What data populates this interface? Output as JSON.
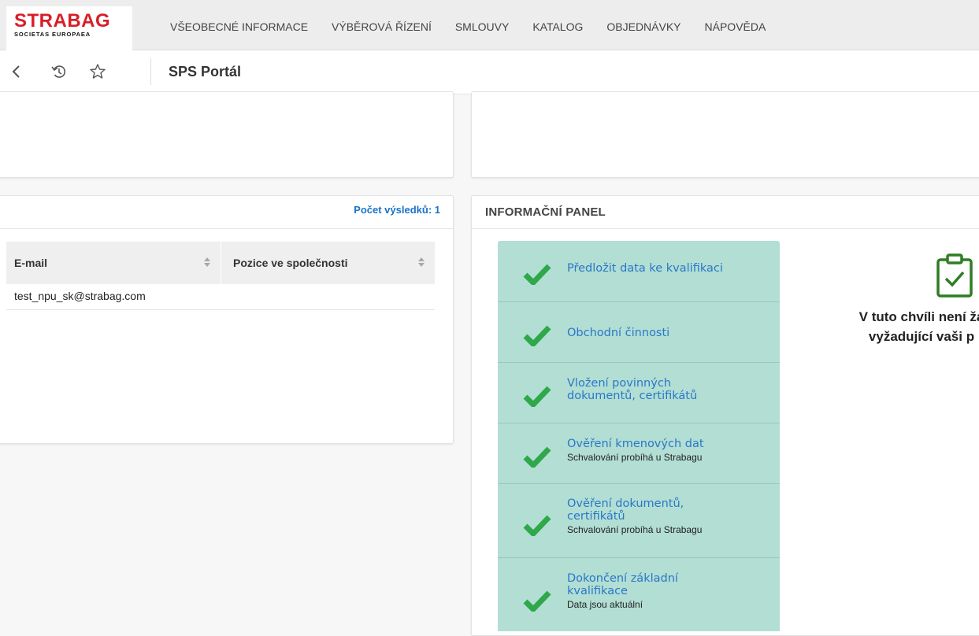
{
  "logo": {
    "main": "STRABAG",
    "sub": "SOCIETAS EUROPAEA"
  },
  "nav": [
    {
      "label": "VŠEOBECNÉ INFORMACE"
    },
    {
      "label": "VÝBĚROVÁ ŘÍZENÍ"
    },
    {
      "label": "SMLOUVY"
    },
    {
      "label": "KATALOG"
    },
    {
      "label": "OBJEDNÁVKY"
    },
    {
      "label": "NÁPOVĚDA"
    }
  ],
  "subbar": {
    "title": "SPS Portál"
  },
  "results": {
    "count_label": "Počet výsledků: 1",
    "columns": [
      "E-mail",
      "Pozice ve společnosti"
    ],
    "rows": [
      [
        "test_npu_sk@strabag.com",
        ""
      ]
    ]
  },
  "info_panel": {
    "title": "INFORMAČNÍ PANEL",
    "steps": [
      {
        "line1": "Předložit data ke kvalifikaci",
        "line2": "",
        "sub": ""
      },
      {
        "line1": "Obchodní činnosti",
        "line2": "",
        "sub": ""
      },
      {
        "line1": "Vložení povinných",
        "line2": "dokumentů, certifikátů",
        "sub": ""
      },
      {
        "line1": "Ověření kmenových dat",
        "line2": "",
        "sub": "Schvalování probíhá u Strabagu"
      },
      {
        "line1": "Ověření dokumentů,",
        "line2": "certifikátů",
        "sub": "Schvalování probíhá u Strabagu"
      },
      {
        "line1": "Dokončení základní",
        "line2": "kvalifikace",
        "sub": "Data jsou aktuální"
      }
    ],
    "notice_line1": "V tuto chvíli není ža",
    "notice_line2": "vyžadující vaši p"
  },
  "colors": {
    "accent": "#2a77c9",
    "brand": "#d81e27",
    "check": "#2ea84a",
    "panel_bg": "#b2ded3"
  }
}
